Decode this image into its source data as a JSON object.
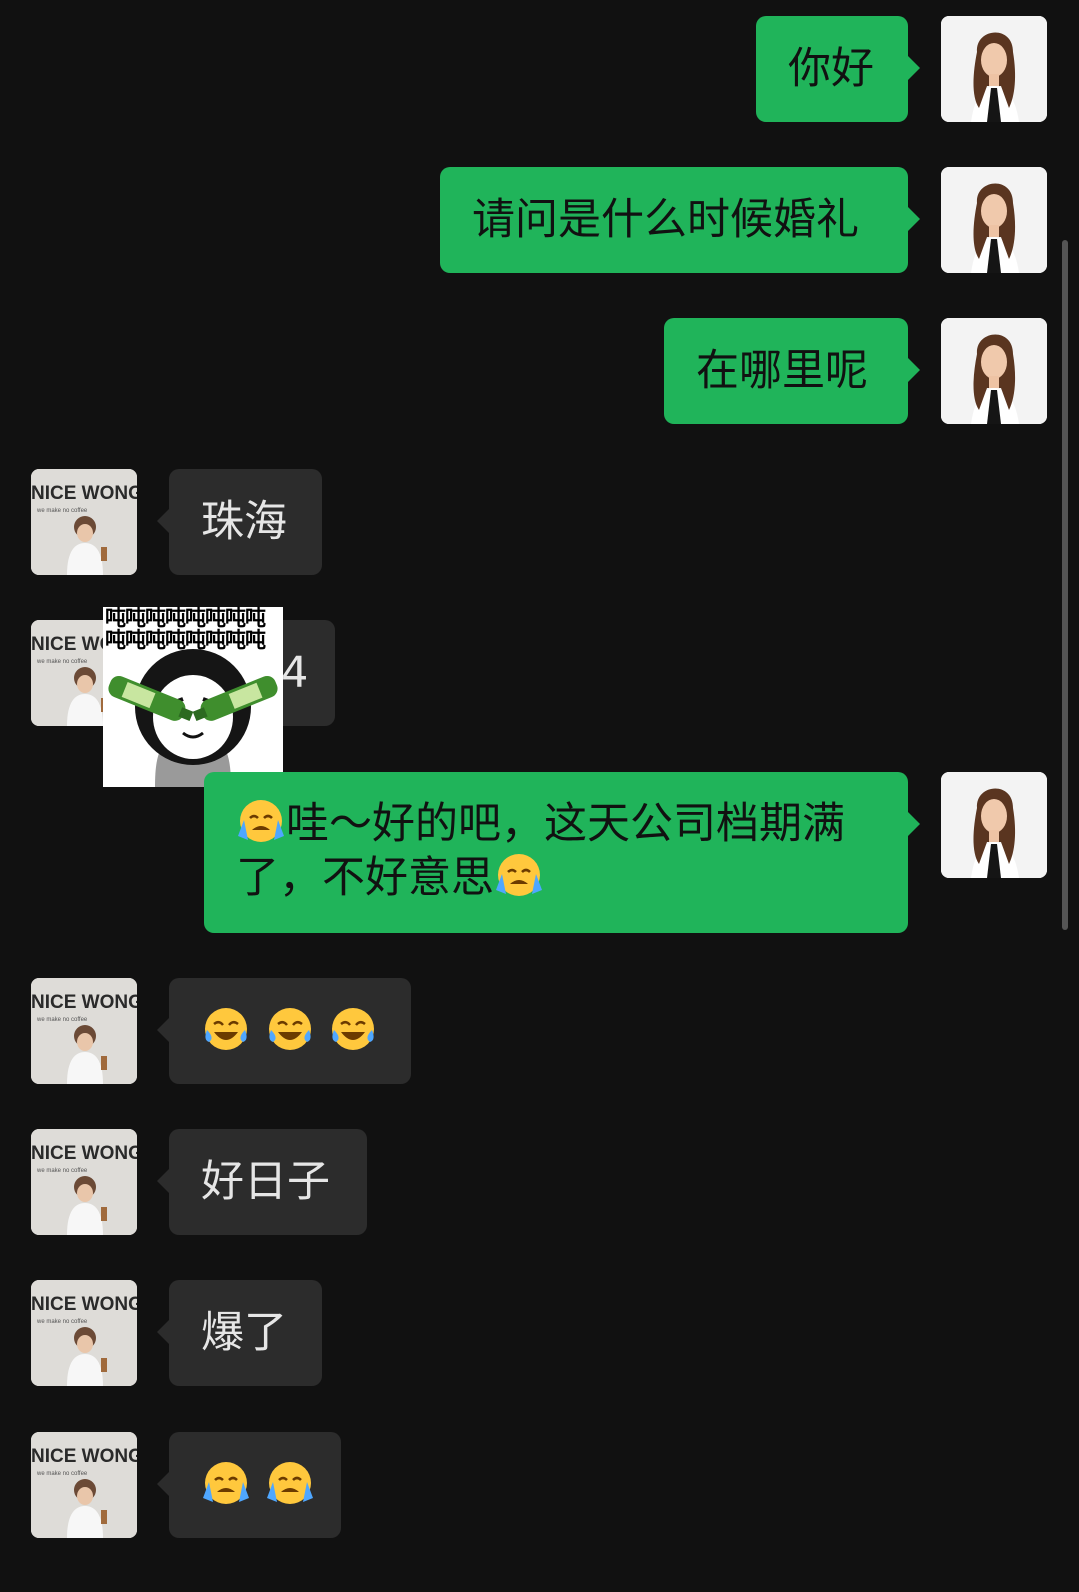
{
  "messages": [
    {
      "side": "out",
      "text": "你好"
    },
    {
      "side": "out",
      "text": "请问是什么时候婚礼"
    },
    {
      "side": "out",
      "text": "在哪里呢"
    },
    {
      "side": "in",
      "text": "珠海"
    },
    {
      "side": "in",
      "text": "4",
      "note_sticker_covering": true
    },
    {
      "side": "out",
      "line1": "哇～好的吧，这天公司档期满",
      "line2": "了，不好意思"
    },
    {
      "side": "in",
      "emoji": [
        "tears-of-joy",
        "tears-of-joy",
        "tears-of-joy"
      ]
    },
    {
      "side": "in",
      "text": "好日子"
    },
    {
      "side": "in",
      "text": "爆了"
    },
    {
      "side": "in",
      "emoji": [
        "loudly-crying",
        "loudly-crying"
      ]
    }
  ],
  "sticker": {
    "text": "吨吨吨吨吨吨吨吨吨吨吨吨吨吨吨吨"
  },
  "contact_avatar": {
    "logo_text": "NICE WONG",
    "tagline": "we make no coffee"
  },
  "colors": {
    "background": "#111111",
    "outgoing_bubble": "#20b45a",
    "incoming_bubble": "#2c2c2c"
  }
}
